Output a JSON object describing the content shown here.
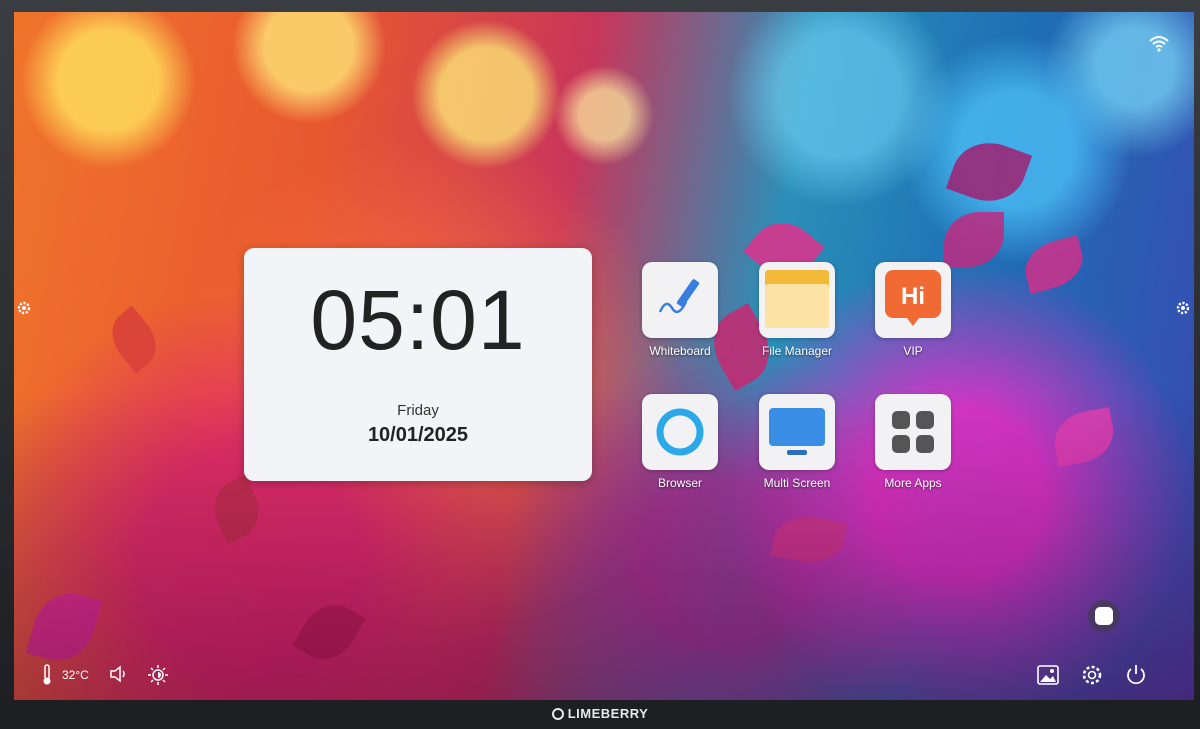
{
  "clock": {
    "time": "05:01",
    "day": "Friday",
    "date": "10/01/2025"
  },
  "apps": [
    {
      "label": "Whiteboard",
      "icon": "whiteboard-icon"
    },
    {
      "label": "File Manager",
      "icon": "folder-icon"
    },
    {
      "label": "VIP",
      "icon": "hi-badge-icon",
      "badge_text": "Hi"
    },
    {
      "label": "Browser",
      "icon": "browser-ring-icon"
    },
    {
      "label": "Multi Screen",
      "icon": "monitor-icon"
    },
    {
      "label": "More Apps",
      "icon": "grid-icon"
    }
  ],
  "status": {
    "temperature": "32°C"
  },
  "brand": {
    "name": "LIMEBERRY"
  },
  "colors": {
    "vip_orange": "#f26a33",
    "browser_blue": "#2aa8e8",
    "monitor_blue": "#3a8ee6",
    "folder_yellow": "#f5b93a"
  }
}
